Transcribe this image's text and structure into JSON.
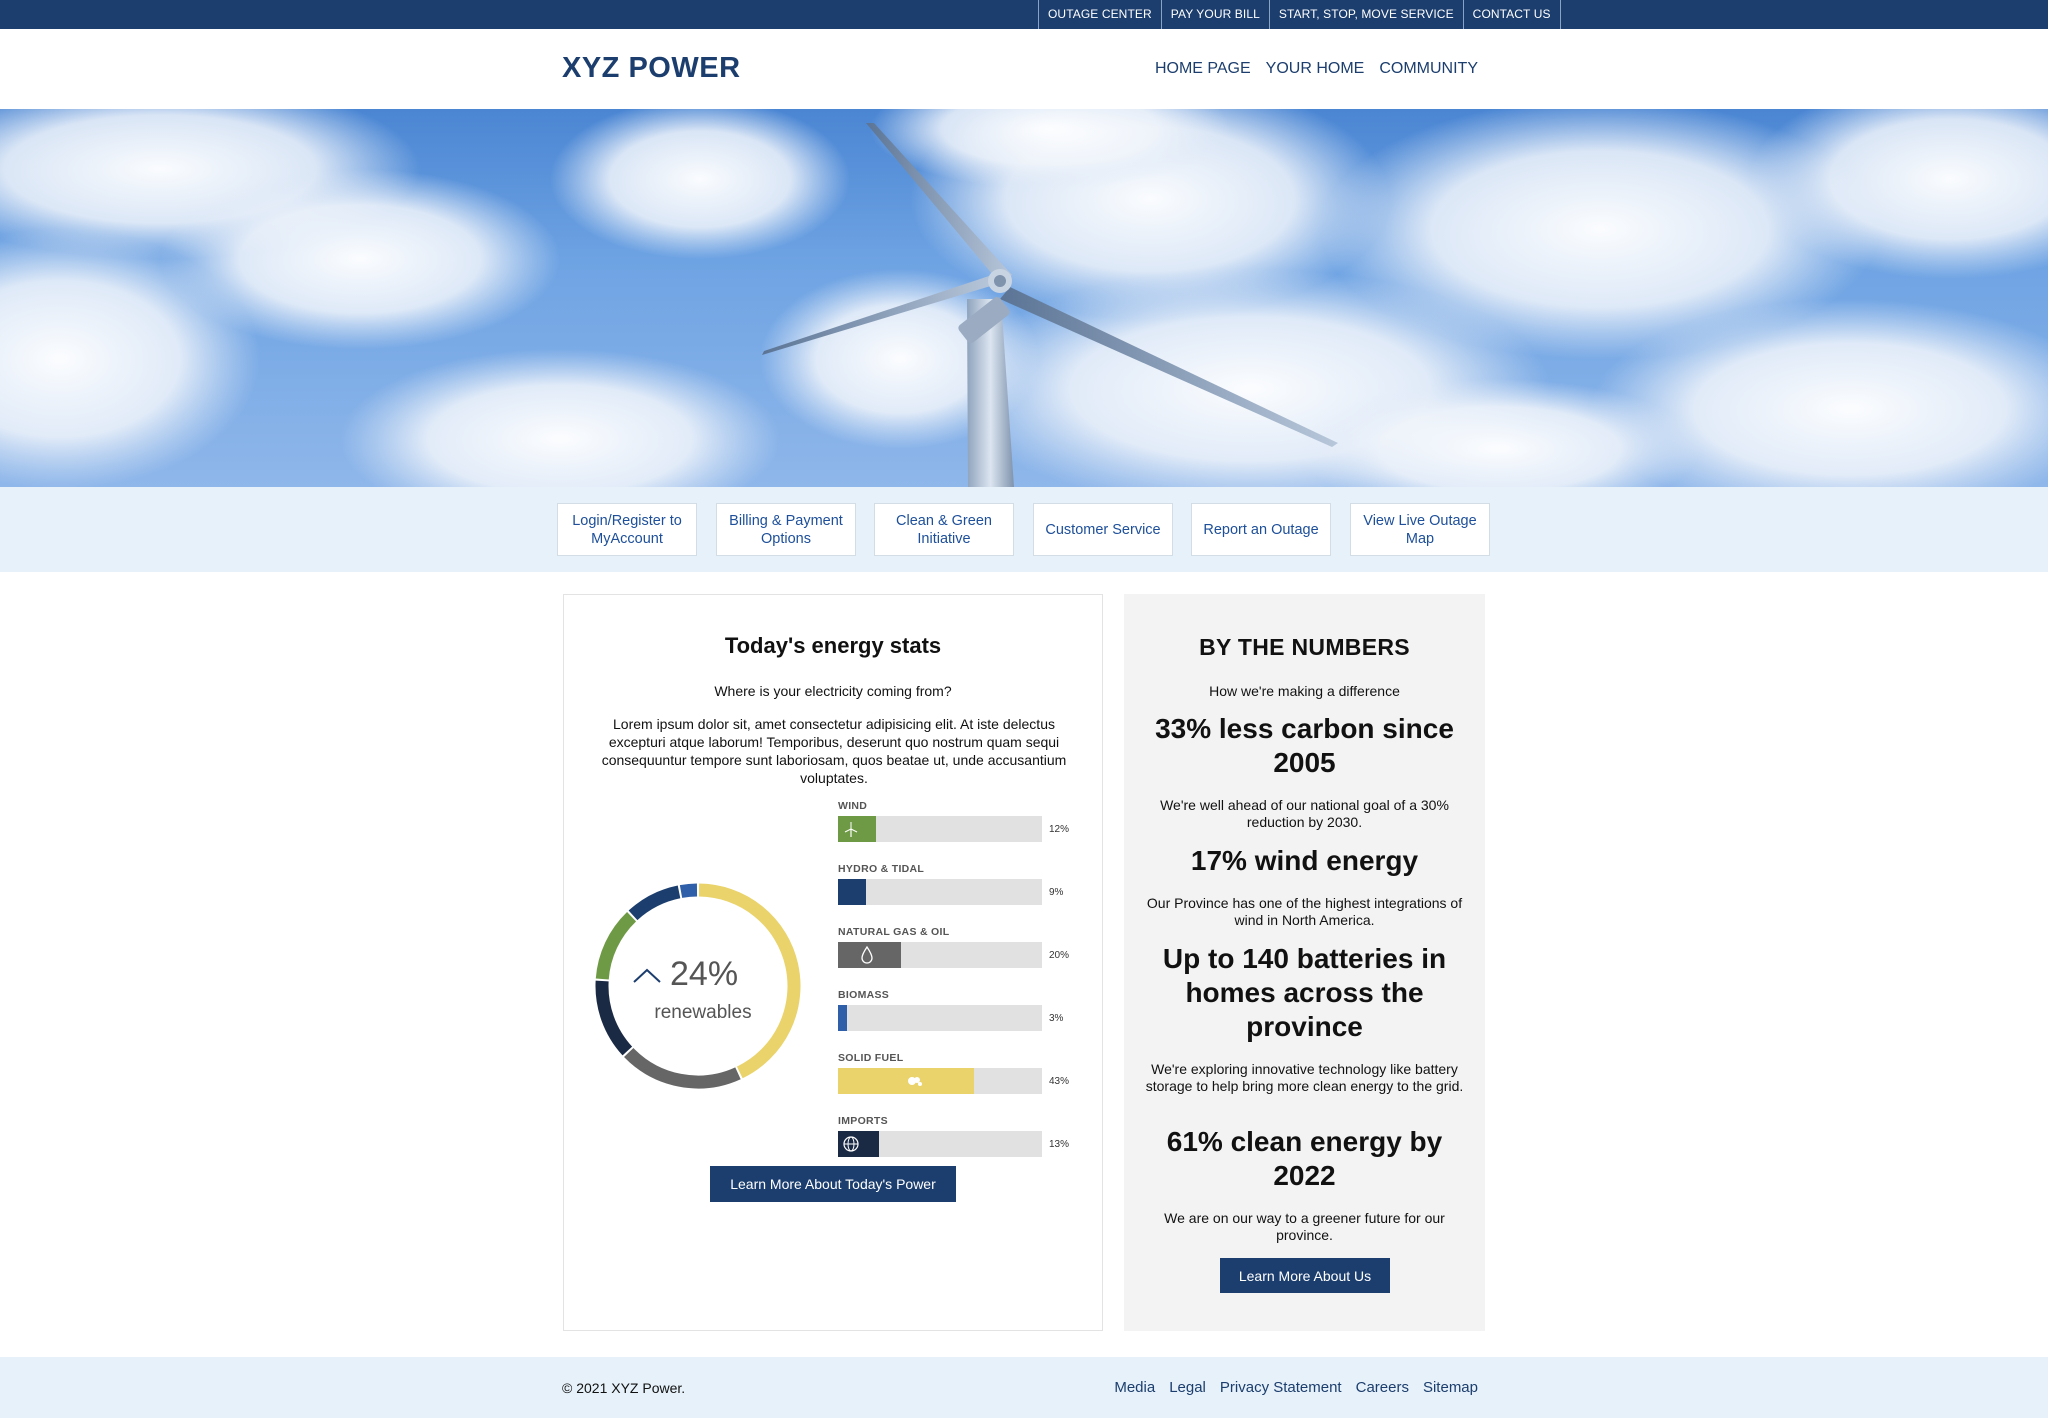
{
  "utility_nav": [
    "OUTAGE CENTER",
    "PAY YOUR BILL",
    "START, STOP, MOVE SERVICE",
    "CONTACT US"
  ],
  "header": {
    "logo": "XYZ POWER",
    "nav": [
      "HOME PAGE",
      "YOUR HOME",
      "COMMUNITY"
    ]
  },
  "hero": {
    "image": "wind-turbine-sky"
  },
  "quick_links": [
    "Login/Register to MyAccount",
    "Billing & Payment Options",
    "Clean & Green Initiative",
    "Customer Service",
    "Report an Outage",
    "View Live Outage Map"
  ],
  "energy_stats": {
    "title": "Today's energy stats",
    "subtitle": "Where is your electricity coming from?",
    "body": "Lorem ipsum dolor sit, amet consectetur adipisicing elit. At iste delectus excepturi atque laborum! Temporibus, deserunt quo nostrum quam sequi consequuntur tempore sunt laboriosam, quos beatae ut, unde accusantium voluptates.",
    "donut_value": "24%",
    "donut_label": "renewables",
    "button": "Learn More About Today's Power"
  },
  "chart_data": {
    "type": "bar",
    "categories": [
      "WIND",
      "HYDRO & TIDAL",
      "NATURAL GAS & OIL",
      "BIOMASS",
      "SOLID FUEL",
      "IMPORTS"
    ],
    "values": [
      12,
      9,
      20,
      3,
      43,
      13
    ],
    "value_labels": [
      "12%",
      "9%",
      "20%",
      "3%",
      "43%",
      "13%"
    ],
    "unit": "%",
    "colors": [
      "#6f9a45",
      "#1c3e6e",
      "#666666",
      "#2f5fa8",
      "#e9d36a",
      "#1b2a44"
    ],
    "icons": [
      "wind-turbine-icon",
      "water-icon",
      "drop-icon",
      "",
      "cloud-icon",
      "globe-icon"
    ],
    "xlim": [
      0,
      100
    ]
  },
  "donut_segments": {
    "order": [
      "SOLID FUEL",
      "NATURAL GAS & OIL",
      "IMPORTS",
      "WIND",
      "HYDRO & TIDAL",
      "BIOMASS"
    ],
    "values": [
      43,
      20,
      13,
      12,
      9,
      3
    ],
    "colors": [
      "#e9d36a",
      "#666666",
      "#1b2a44",
      "#6f9a45",
      "#1c3e6e",
      "#2f5fa8"
    ]
  },
  "by_numbers": {
    "title": "BY THE NUMBERS",
    "subtitle": "How we're making a difference",
    "items": [
      {
        "stat": "33% less carbon since 2005",
        "desc": "We're well ahead of our national goal of a 30% reduction by 2030."
      },
      {
        "stat": "17% wind energy",
        "desc": "Our Province has one of the highest integrations of wind in North America."
      },
      {
        "stat": "Up to 140 batteries in homes across the province",
        "desc": "We're exploring innovative technology like battery storage to help bring more clean energy to the grid."
      },
      {
        "stat": "61% clean energy by 2022",
        "desc": "We are on our way to a greener future for our province."
      }
    ],
    "button": "Learn More About Us"
  },
  "footer": {
    "copyright": "© 2021 XYZ Power.",
    "links": [
      "Media",
      "Legal",
      "Privacy Statement",
      "Careers",
      "Sitemap"
    ]
  }
}
